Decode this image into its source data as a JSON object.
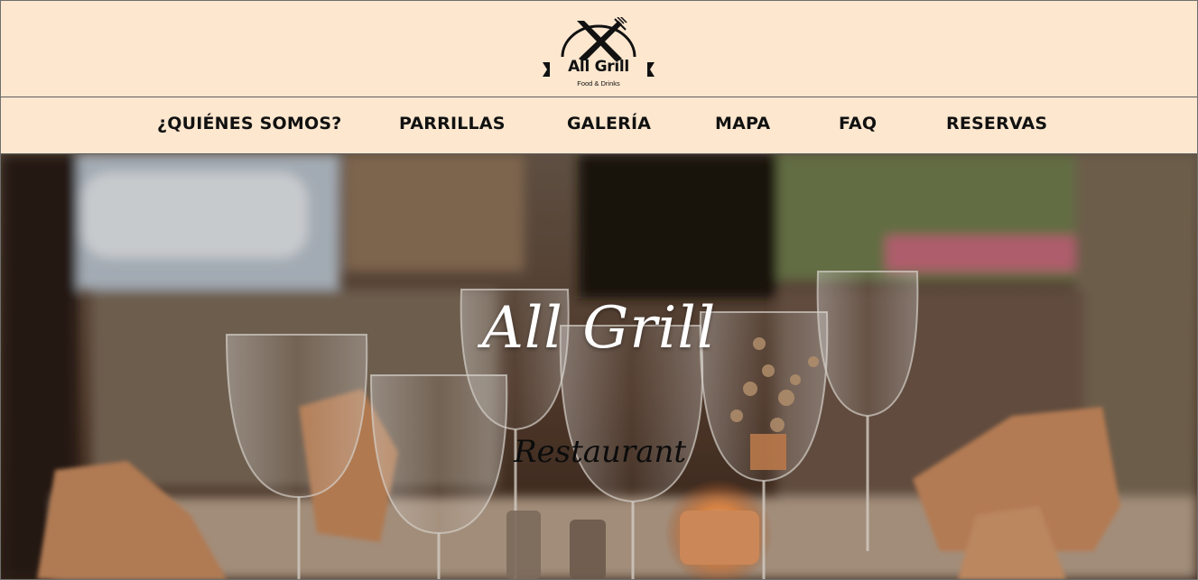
{
  "header": {
    "logo": {
      "title": "All Grill",
      "subtitle": "Food & Drinks"
    }
  },
  "nav": {
    "items": [
      {
        "label": "¿QUIÉNES SOMOS?"
      },
      {
        "label": "PARRILLAS"
      },
      {
        "label": "GALERÍA"
      },
      {
        "label": "MAPA"
      },
      {
        "label": "FAQ"
      },
      {
        "label": "RESERVAS"
      }
    ]
  },
  "hero": {
    "title": "All Grill",
    "subtitle": "Restaurant"
  },
  "colors": {
    "header_bg": "#fde7cf",
    "text": "#111111",
    "hero_title": "#ffffff"
  }
}
